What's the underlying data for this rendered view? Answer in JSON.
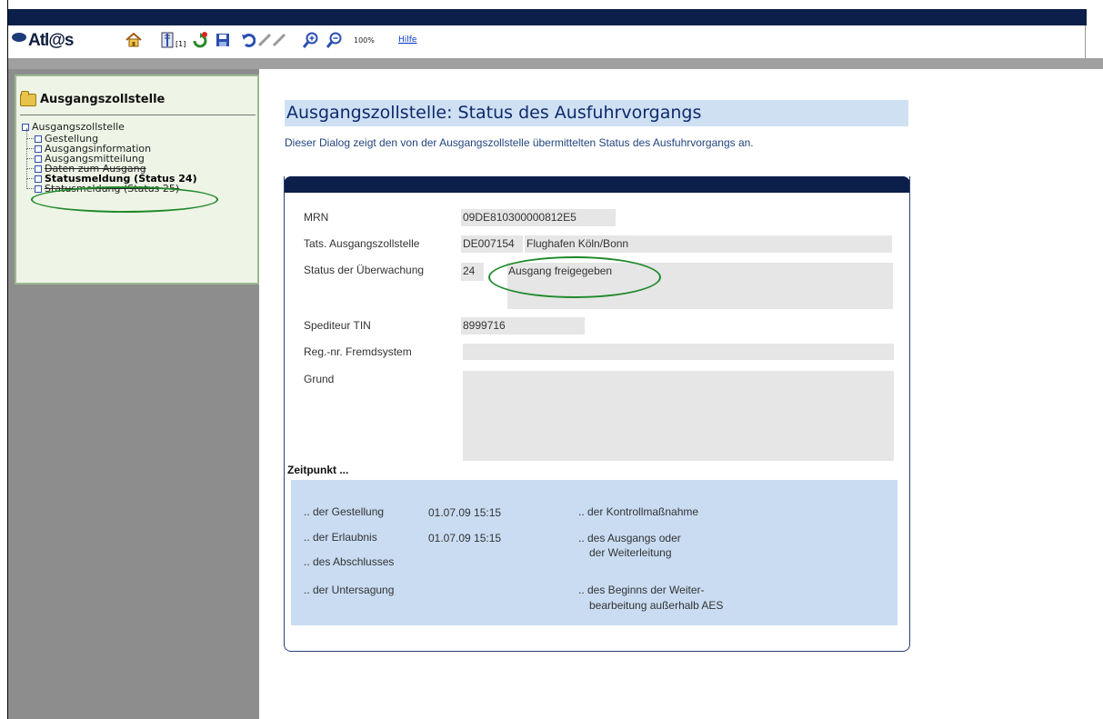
{
  "toolbar": {
    "logo": "Atl@s",
    "printer_count": "[1]",
    "zoom": "100%",
    "help": "Hilfe"
  },
  "nav": {
    "title": "Ausgangszollstelle",
    "root": "Ausgangszollstelle",
    "items": [
      {
        "label": "Gestellung"
      },
      {
        "label": "Ausgangsinformation"
      },
      {
        "label": "Ausgangsmitteilung"
      },
      {
        "label": "Daten zum Ausgang"
      },
      {
        "label": "Statusmeldung (Status 24)"
      },
      {
        "label": "Statusmeldung (Status 25)"
      }
    ]
  },
  "page": {
    "title": "Ausgangszollstelle: Status des Ausfuhrvorgangs",
    "description": "Dieser Dialog zeigt den von der Ausgangszollstelle übermittelten Status des Ausfuhrvorgangs an."
  },
  "form": {
    "mrn_label": "MRN",
    "mrn_value": "09DE810300000812E5",
    "office_label": "Tats. Ausgangszollstelle",
    "office_code": "DE007154",
    "office_name": "Flughafen Köln/Bonn",
    "status_label": "Status der Überwachung",
    "status_code": "24",
    "status_text": "Ausgang freigegeben",
    "tin_label": "Spediteur TIN",
    "tin_value": "8999716",
    "reg_label": "Reg.-nr. Fremdsystem",
    "reg_value": "",
    "grund_label": "Grund",
    "grund_value": ""
  },
  "zeitpunkt": {
    "title": "Zeitpunkt ...",
    "gestellung_label": ".. der Gestellung",
    "gestellung_value": "01.07.09 15:15",
    "erlaubnis_label": ".. der Erlaubnis",
    "erlaubnis_value": "01.07.09 15:15",
    "abschluss_label": ".. des Abschlusses",
    "untersagung_label": ".. der Untersagung",
    "kontroll_label": ".. der Kontrollmaßnahme",
    "ausgang_label_1": ".. des Ausgangs oder",
    "ausgang_label_2": "der Weiterleitung",
    "beginn_label_1": ".. des Beginns der Weiter-",
    "beginn_label_2": "bearbeitung außerhalb AES"
  },
  "colors": {
    "navy": "#0b1f4a",
    "title_bg": "#cfe0f3",
    "title_text": "#0d2a6b",
    "zeit_bg": "#c9dcf2",
    "highlight_ellipse": "#1f8a2a",
    "nav_bg": "#eef4e6"
  }
}
